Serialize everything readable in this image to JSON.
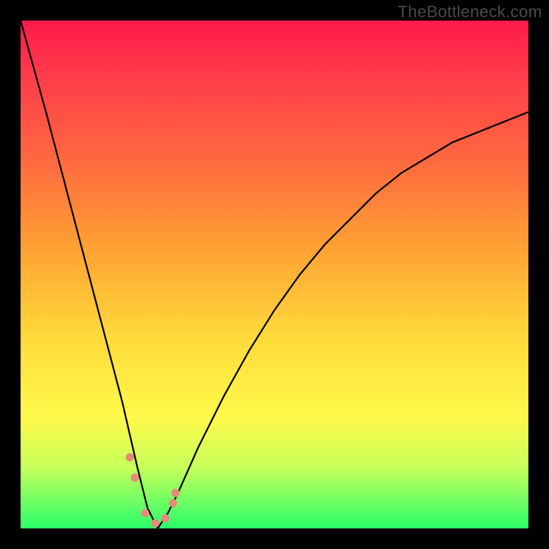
{
  "watermark": "TheBottleneck.com",
  "chart_data": {
    "type": "line",
    "title": "",
    "xlabel": "",
    "ylabel": "",
    "xlim": [
      0,
      100
    ],
    "ylim": [
      0,
      100
    ],
    "grid": false,
    "curve": {
      "description": "V-shaped bottleneck curve; value is approximate mismatch percentage vs x (component balance index). Minimum near x≈27, rising steeply on both sides.",
      "x": [
        0,
        5,
        10,
        15,
        20,
        23,
        25,
        27,
        29,
        31,
        35,
        40,
        45,
        50,
        55,
        60,
        65,
        70,
        75,
        80,
        85,
        90,
        95,
        100
      ],
      "values": [
        100,
        82,
        63,
        44,
        25,
        12,
        4,
        0,
        3,
        7,
        16,
        26,
        35,
        43,
        50,
        56,
        61,
        66,
        70,
        73,
        76,
        78,
        80,
        82
      ]
    },
    "markers": {
      "description": "highlighted sample points near the trough",
      "x": [
        21.5,
        22.5,
        24.5,
        26.5,
        28.5,
        30.0,
        30.5
      ],
      "values": [
        14,
        10,
        3,
        1,
        2,
        5,
        7
      ]
    },
    "gradient_stops": [
      {
        "pos": 0.0,
        "color": "#ff1a4b"
      },
      {
        "pos": 0.12,
        "color": "#ff3f49"
      },
      {
        "pos": 0.28,
        "color": "#ff6a3f"
      },
      {
        "pos": 0.45,
        "color": "#ffa233"
      },
      {
        "pos": 0.62,
        "color": "#ffd93a"
      },
      {
        "pos": 0.78,
        "color": "#fff94a"
      },
      {
        "pos": 0.88,
        "color": "#c7ff5a"
      },
      {
        "pos": 1.0,
        "color": "#2aff6a"
      }
    ],
    "colors": {
      "curve": "#000000",
      "marker": "#e88a79",
      "background_border": "#000000"
    }
  }
}
